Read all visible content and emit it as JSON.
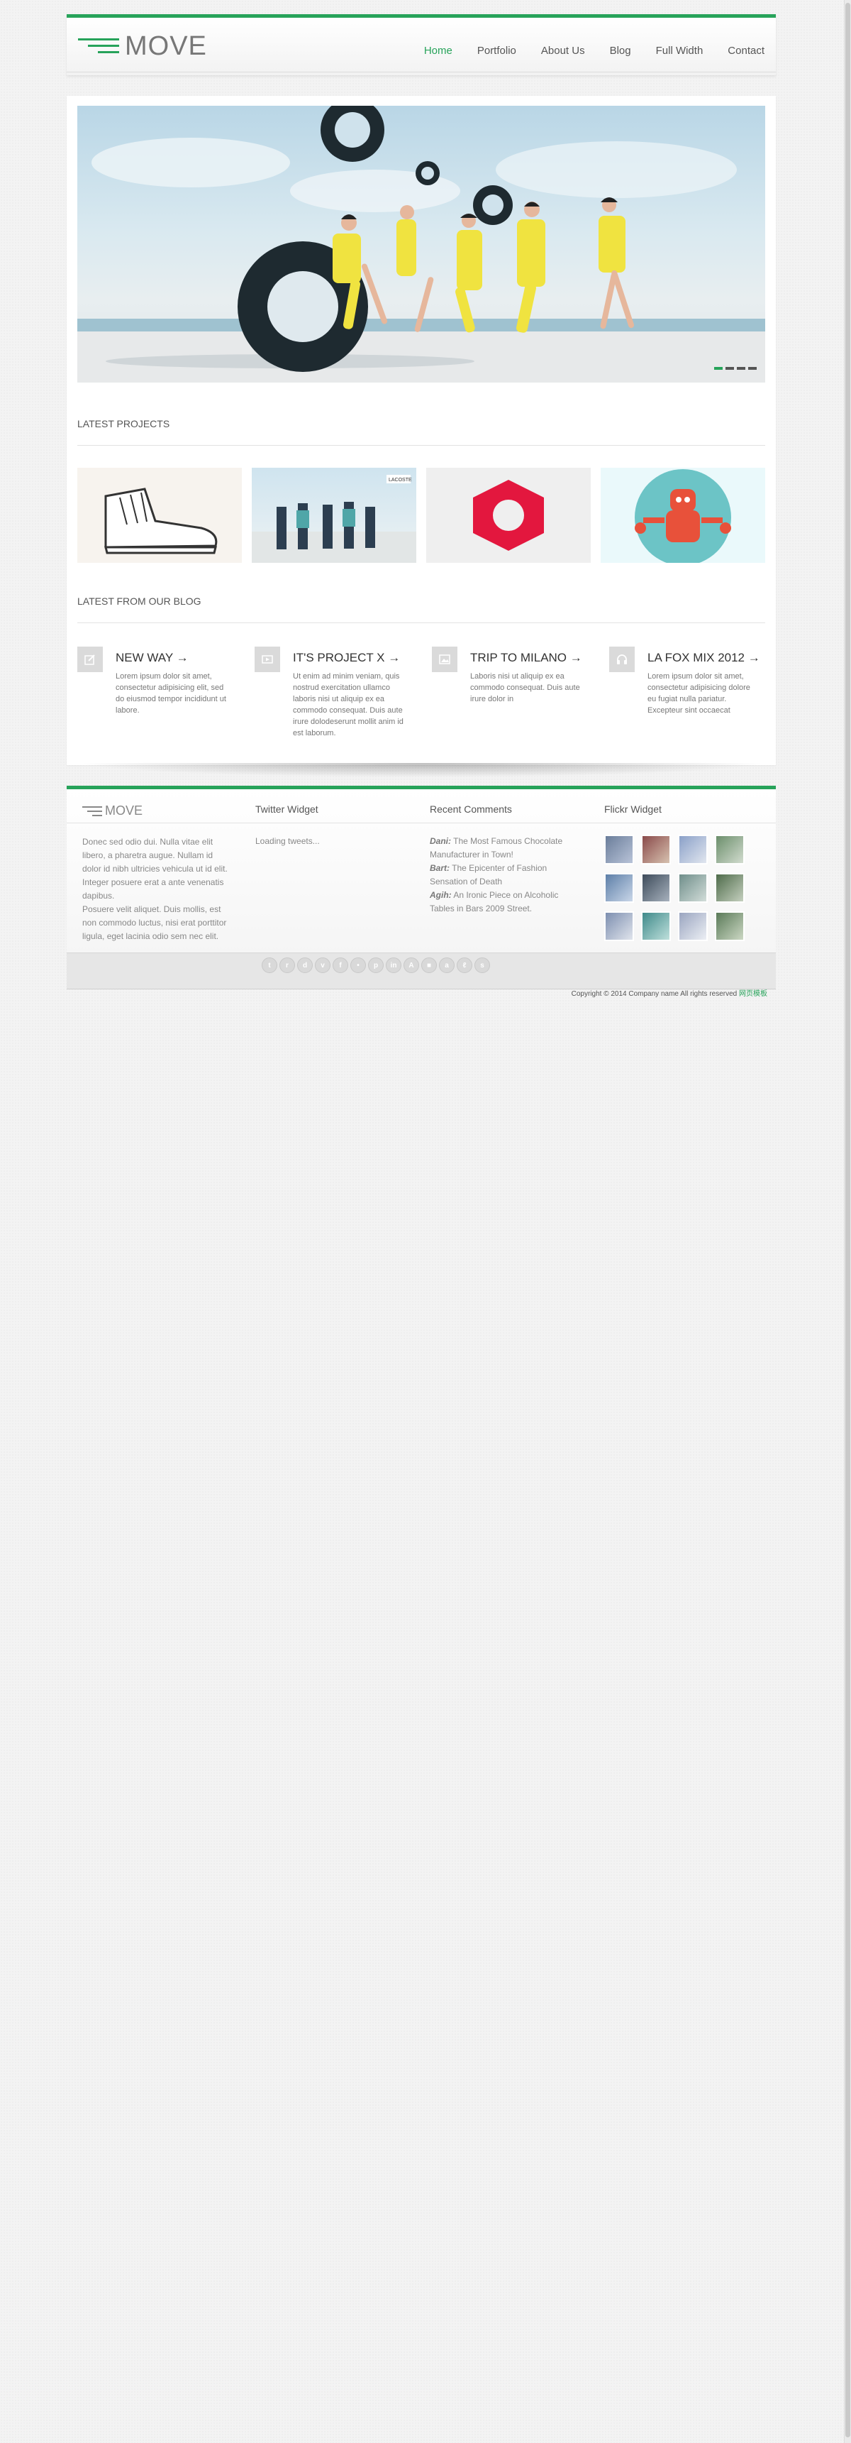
{
  "brand": {
    "name": "MOVE",
    "accent": "#27a35a"
  },
  "nav": {
    "items": [
      "Home",
      "Portfolio",
      "About Us",
      "Blog",
      "Full Width",
      "Contact"
    ],
    "active": "Home"
  },
  "slider": {
    "slides": 4,
    "active": 1
  },
  "projects": {
    "title": "LATEST PROJECTS"
  },
  "blog": {
    "title": "LATEST FROM OUR BLOG",
    "posts": [
      {
        "title": "NEW WAY →",
        "icon": "edit-icon",
        "text": "Lorem ipsum dolor sit amet, consectetur adipisicing elit, sed do eiusmod tempor incididunt ut labore."
      },
      {
        "title": "IT'S PROJECT X →",
        "icon": "video-icon",
        "text": "Ut enim ad minim veniam, quis nostrud exercitation ullamco laboris nisi ut aliquip ex ea commodo consequat. Duis aute irure dolodeserunt mollit anim id est laborum."
      },
      {
        "title": "TRIP TO MILANO →",
        "icon": "image-icon",
        "text": "Laboris nisi ut aliquip ex ea commodo consequat. Duis aute irure dolor in"
      },
      {
        "title": "LA FOX MIX 2012 →",
        "icon": "headphones-icon",
        "text": "Lorem ipsum dolor sit amet, consectetur adipisicing dolore eu fugiat nulla pariatur. Excepteur sint occaecat"
      }
    ]
  },
  "footer": {
    "about_text": "Donec sed odio dui. Nulla vitae elit libero, a pharetra augue. Nullam id dolor id nibh ultricies vehicula ut id elit. Integer posuere erat a ante venenatis dapibus.",
    "about_text2": "Posuere velit aliquet. Duis mollis, est non commodo luctus, nisi erat porttitor ligula, eget lacinia odio sem nec elit.",
    "twitter_title": "Twitter Widget",
    "twitter_status": "Loading tweets...",
    "comments_title": "Recent Comments",
    "comments": [
      {
        "author": "Dani:",
        "text": "The Most Famous Chocolate Manufacturer in Town!"
      },
      {
        "author": "Bart:",
        "text": "The Epicenter of Fashion Sensation of Death"
      },
      {
        "author": "Agih:",
        "text": "An Ironic Piece on Alcoholic Tables in Bars 2009 Street."
      }
    ],
    "flickr_title": "Flickr Widget",
    "social": [
      "twitter-icon",
      "rss-icon",
      "dribbble-icon",
      "vimeo-icon",
      "facebook-icon",
      "flickr-icon",
      "pinterest-icon",
      "linkedin-icon",
      "appstore-icon",
      "delicious-icon",
      "android-icon",
      "lastfm-icon",
      "skype-icon"
    ],
    "social_glyphs": [
      "t",
      "r",
      "d",
      "v",
      "f",
      "•",
      "p",
      "in",
      "A",
      "■",
      "a",
      "ℓ",
      "s"
    ],
    "copyright": "Copyright © 2014 Company name All rights reserved",
    "copyright_link": "网页模板"
  }
}
